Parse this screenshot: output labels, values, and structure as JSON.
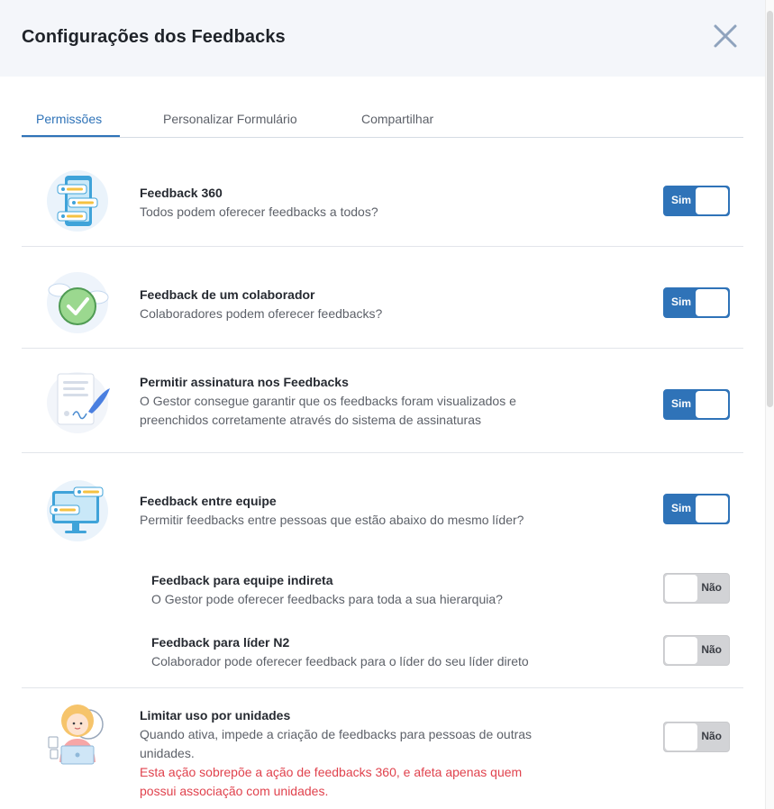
{
  "modal": {
    "title": "Configurações dos Feedbacks",
    "close_icon": "close-icon"
  },
  "tabs": [
    {
      "label": "Permissões",
      "active": true
    },
    {
      "label": "Personalizar Formulário",
      "active": false
    },
    {
      "label": "Compartilhar",
      "active": false
    }
  ],
  "toggle_labels": {
    "on": "Sim",
    "off": "Não"
  },
  "settings": {
    "feedback360": {
      "name": "Feedback 360",
      "description": "Todos podem oferecer feedbacks a todos?",
      "enabled": true,
      "toggle_label": "Sim",
      "icon": "phone-feedback-illustration"
    },
    "colaborador": {
      "name": "Feedback de um colaborador",
      "description": "Colaboradores podem oferecer feedbacks?",
      "enabled": true,
      "toggle_label": "Sim",
      "icon": "checkmark-cloud-illustration"
    },
    "assinatura": {
      "name": "Permitir assinatura nos Feedbacks",
      "description_line1": "O Gestor consegue garantir que os feedbacks foram visualizados e",
      "description_line2": "preenchidos corretamente através do sistema de assinaturas",
      "enabled": true,
      "toggle_label": "Sim",
      "icon": "document-signature-illustration"
    },
    "equipe": {
      "name": "Feedback entre equipe",
      "description": "Permitir feedbacks entre pessoas que estão abaixo do mesmo líder?",
      "enabled": true,
      "toggle_label": "Sim",
      "icon": "monitor-feedback-illustration"
    },
    "equipe_indireta": {
      "name": "Feedback para equipe indireta",
      "description": "O Gestor pode oferecer feedbacks para toda a sua hierarquia?",
      "enabled": false,
      "toggle_label": "Não"
    },
    "lider_n2": {
      "name": "Feedback para líder N2",
      "description": "Colaborador pode oferecer feedback para o líder do seu líder direto",
      "enabled": false,
      "toggle_label": "Não"
    },
    "unidades": {
      "name": "Limitar uso por unidades",
      "description_line1": "Quando ativa, impede a criação de feedbacks para pessoas de outras",
      "description_line2": "unidades.",
      "warning_line1": "Esta ação sobrepõe a ação de feedbacks 360, e afeta apenas quem",
      "warning_line2": "possui associação com unidades.",
      "enabled": false,
      "toggle_label": "Não",
      "icon": "person-laptop-illustration"
    }
  },
  "colors": {
    "accent": "#2f73b8",
    "header_bg": "#f4f6fa",
    "warning": "#e0424d",
    "toggle_off": "#d2d3d6"
  }
}
